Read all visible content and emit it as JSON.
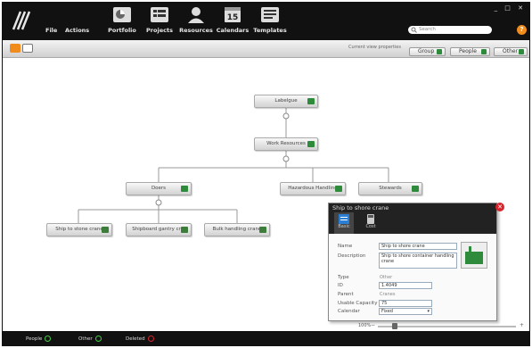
{
  "menu": {
    "file": "File",
    "actions": "Actions"
  },
  "nav": [
    {
      "label": "Portfolio",
      "icon": "portfolio-icon"
    },
    {
      "label": "Projects",
      "icon": "projects-icon"
    },
    {
      "label": "Resources",
      "icon": "resources-icon"
    },
    {
      "label": "Calendars",
      "icon": "calendar-icon",
      "day": "15"
    },
    {
      "label": "Templates",
      "icon": "templates-icon"
    }
  ],
  "search": {
    "placeholder": "Search"
  },
  "window_controls": "_ □ ✕",
  "help_label": "?",
  "toolbar": {
    "breadcrumb": "Current view properties",
    "group_label": "Group",
    "people_label": "People",
    "other_label": "Other"
  },
  "org": {
    "root": "Labelgue",
    "level2": "Work Resources",
    "level3": [
      "Doers",
      "Hazardous Handling",
      "Stewards"
    ],
    "level4": [
      "Ship to stone crane",
      "Shipboard gantry cr...",
      "Bulk handling crane"
    ]
  },
  "popup": {
    "title": "Ship to shore crane",
    "tabs": [
      {
        "label": "Basic"
      },
      {
        "label": "Cost"
      }
    ],
    "fields": {
      "name_label": "Name",
      "name_value": "Ship to shore crane",
      "description_label": "Description",
      "description_value": "Ship to shore container handling crane",
      "type_label": "Type",
      "type_value": "Other",
      "id_label": "ID",
      "id_value": "1.4049",
      "parent_label": "Parent",
      "parent_value": "Cranes",
      "usable_capacity_label": "Usable Capacity",
      "usable_capacity_value": "75",
      "calendar_label": "Calendar",
      "calendar_value": "Fixed"
    }
  },
  "zoom": {
    "label": "100%",
    "level": 0.12
  },
  "status": {
    "people": "People",
    "other": "Other",
    "deleted": "Deleted"
  },
  "colors": {
    "accent_green": "#2e8b3c",
    "close_red": "#d9232d",
    "help_orange": "#f08b1c"
  }
}
